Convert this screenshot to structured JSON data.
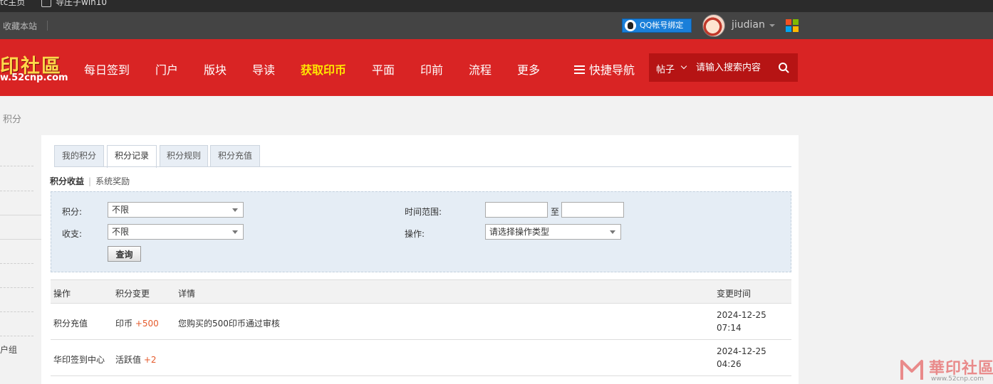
{
  "browser": {
    "bookmark1": "tc主页",
    "bookmark2": "导圧子win10"
  },
  "toolbar": {
    "favorite_label": "收藏本站",
    "qq_bind_label": "QQ帐号绑定",
    "username": "jiudian"
  },
  "logo": {
    "main": "印社區",
    "sub": "w.52cnp.com"
  },
  "nav": {
    "items": [
      {
        "label": "每日签到"
      },
      {
        "label": "门户"
      },
      {
        "label": "版块"
      },
      {
        "label": "导读"
      },
      {
        "label": "获取印币"
      },
      {
        "label": "平面"
      },
      {
        "label": "印前"
      },
      {
        "label": "流程"
      },
      {
        "label": "更多"
      }
    ],
    "quick_nav_label": "快捷导航"
  },
  "search": {
    "type_label": "帖子",
    "placeholder": "请输入搜索内容"
  },
  "breadcrumb": {
    "current": "积分"
  },
  "sidebar": {
    "partial_text": "户组"
  },
  "tabs": [
    {
      "label": "我的积分"
    },
    {
      "label": "积分记录"
    },
    {
      "label": "积分规则"
    },
    {
      "label": "积分充值"
    }
  ],
  "subnav": {
    "active": "积分收益",
    "other": "系统奖励"
  },
  "filter": {
    "credit_label": "积分:",
    "credit_value": "不限",
    "direction_label": "收支:",
    "direction_value": "不限",
    "time_label": "时间范围:",
    "to_label": "至",
    "operation_label": "操作:",
    "operation_value": "请选择操作类型",
    "query_button": "查询"
  },
  "table": {
    "headers": [
      "操作",
      "积分变更",
      "详情",
      "变更时间"
    ],
    "rows": [
      {
        "operation": "积分充值",
        "credit": "印币",
        "change": "+500",
        "detail": "您购买的500印币通过审核",
        "date": "2024-12-25",
        "time": "07:14"
      },
      {
        "operation": "华印签到中心",
        "credit": "活跃值",
        "change": "+2",
        "detail": "",
        "date": "2024-12-25",
        "time": "04:26"
      }
    ]
  },
  "watermark": {
    "text": "華印社區",
    "url": "www.52cnp.com"
  },
  "colors": {
    "nav_red": "#d92424",
    "search_dark_red": "#b61414",
    "highlight_yellow": "#ffe600",
    "plus_orange": "#e55a2b"
  }
}
